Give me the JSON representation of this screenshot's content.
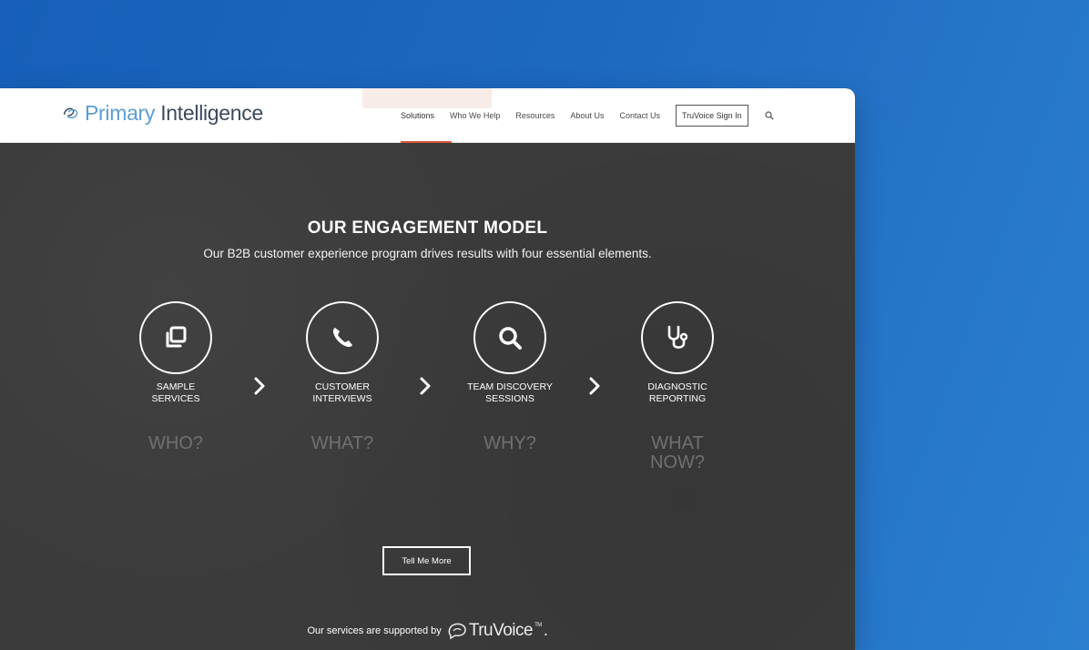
{
  "brand": {
    "name_part1": "Primary",
    "name_part2": "Intelligence",
    "icon": "primary-intelligence-logo-icon"
  },
  "nav": {
    "items": [
      {
        "label": "Solutions",
        "active": true
      },
      {
        "label": "Who We Help",
        "active": false
      },
      {
        "label": "Resources",
        "active": false
      },
      {
        "label": "About Us",
        "active": false
      },
      {
        "label": "Contact Us",
        "active": false
      }
    ],
    "signin_label": "TruVoice Sign In",
    "search_icon": "search-icon",
    "accent_color": "#d9553a"
  },
  "hero": {
    "title": "OUR ENGAGEMENT MODEL",
    "subtitle": "Our B2B customer experience program drives results with four essential elements.",
    "steps": [
      {
        "label_line1": "SAMPLE",
        "label_line2": "SERVICES",
        "question_line1": "WHO?",
        "question_line2": "",
        "icon": "copy-icon"
      },
      {
        "label_line1": "CUSTOMER",
        "label_line2": "INTERVIEWS",
        "question_line1": "WHAT?",
        "question_line2": "",
        "icon": "phone-icon"
      },
      {
        "label_line1": "TEAM DISCOVERY",
        "label_line2": "SESSIONS",
        "question_line1": "WHY?",
        "question_line2": "",
        "icon": "magnifier-icon"
      },
      {
        "label_line1": "DIAGNOSTIC",
        "label_line2": "REPORTING",
        "question_line1": "WHAT",
        "question_line2": "NOW?",
        "icon": "stethoscope-icon"
      }
    ],
    "cta_label": "Tell Me More",
    "supported_text": "Our services are supported by",
    "truvoice_name": "TruVoice",
    "truvoice_tm": "TM",
    "truvoice_trailing": "."
  },
  "colors": {
    "background_gradient_start": "#175fba",
    "background_gradient_end": "#2b7fcf",
    "hero_bg": "#3b3b3b",
    "logo_light": "#5b9fd1",
    "logo_dark": "#3b4a5c"
  }
}
